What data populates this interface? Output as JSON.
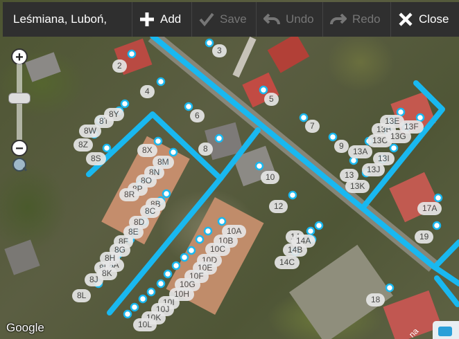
{
  "toolbar": {
    "search_value": "Leśmiana, Luboń,",
    "add_label": "Add",
    "save_label": "Save",
    "undo_label": "Undo",
    "redo_label": "Redo",
    "close_label": "Close"
  },
  "map": {
    "attribution": "Google",
    "street_label": "na",
    "address_labels": [
      "2",
      "3",
      "4",
      "5",
      "6",
      "7",
      "8",
      "9",
      "10",
      "12",
      "13",
      "13A",
      "13B",
      "13C",
      "13E",
      "13F",
      "13G",
      "13I",
      "13J",
      "13K",
      "14",
      "14A",
      "14B",
      "14C",
      "17A",
      "18",
      "19",
      "8A",
      "8B",
      "8C",
      "8D",
      "8E",
      "8F",
      "8G",
      "8H",
      "8I",
      "8J",
      "8K",
      "8L",
      "8M",
      "8N",
      "8O",
      "8P",
      "8R",
      "8S",
      "8T",
      "8W",
      "8X",
      "8Y",
      "8Z",
      "10A",
      "10B",
      "10C",
      "10D",
      "10E",
      "10F",
      "10G",
      "10H",
      "10I",
      "10J",
      "10K",
      "10L"
    ]
  },
  "colors": {
    "path": "#19b8f0",
    "toolbar_bg": "#2f2f2f",
    "label_bg": "#e6e6e6"
  }
}
